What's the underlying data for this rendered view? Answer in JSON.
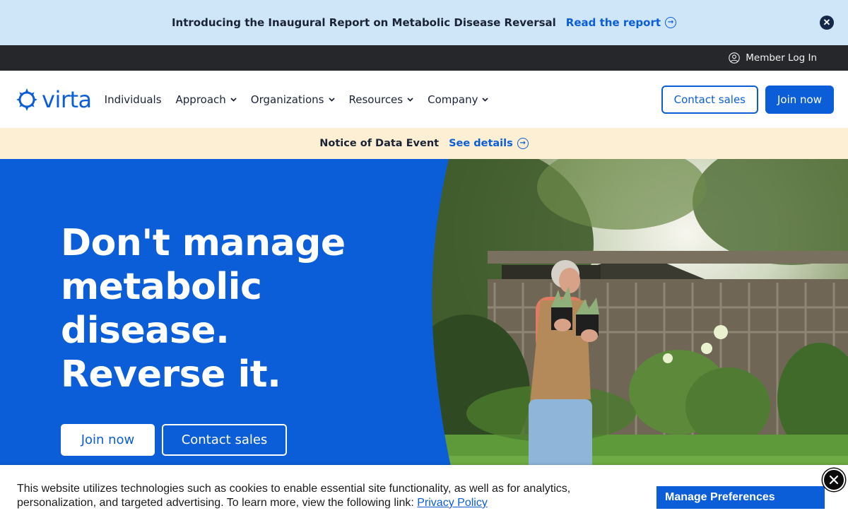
{
  "announcement": {
    "text": "Introducing the Inaugural Report on Metabolic Disease Reversal",
    "link_label": "Read the report",
    "close_icon": "close-circle-icon"
  },
  "utility": {
    "member_login_label": "Member Log In",
    "icon": "user-circle-icon"
  },
  "nav": {
    "logo_text": "virta",
    "items": [
      {
        "label": "Individuals",
        "has_dropdown": false
      },
      {
        "label": "Approach",
        "has_dropdown": true
      },
      {
        "label": "Organizations",
        "has_dropdown": true
      },
      {
        "label": "Resources",
        "has_dropdown": true
      },
      {
        "label": "Company",
        "has_dropdown": true
      }
    ],
    "contact_sales_label": "Contact sales",
    "join_now_label": "Join now"
  },
  "notice": {
    "text": "Notice of Data Event",
    "link_label": "See details"
  },
  "hero": {
    "title_lines": [
      "Don't manage",
      "metabolic",
      "disease.",
      "Reverse it."
    ],
    "join_now_label": "Join now",
    "contact_sales_label": "Contact sales"
  },
  "cookie": {
    "text": "This website utilizes technologies such as cookies to enable essential site functionality, as well as for analytics, personalization, and targeted advertising. To learn more, view the following link:",
    "link_label": "Privacy Policy",
    "manage_label": "Manage Preferences"
  },
  "colors": {
    "brand_blue": "#0b5ed7",
    "announce_bg": "#cfe6f9",
    "utility_bg": "#26272b",
    "notice_bg": "#fcefd4"
  }
}
